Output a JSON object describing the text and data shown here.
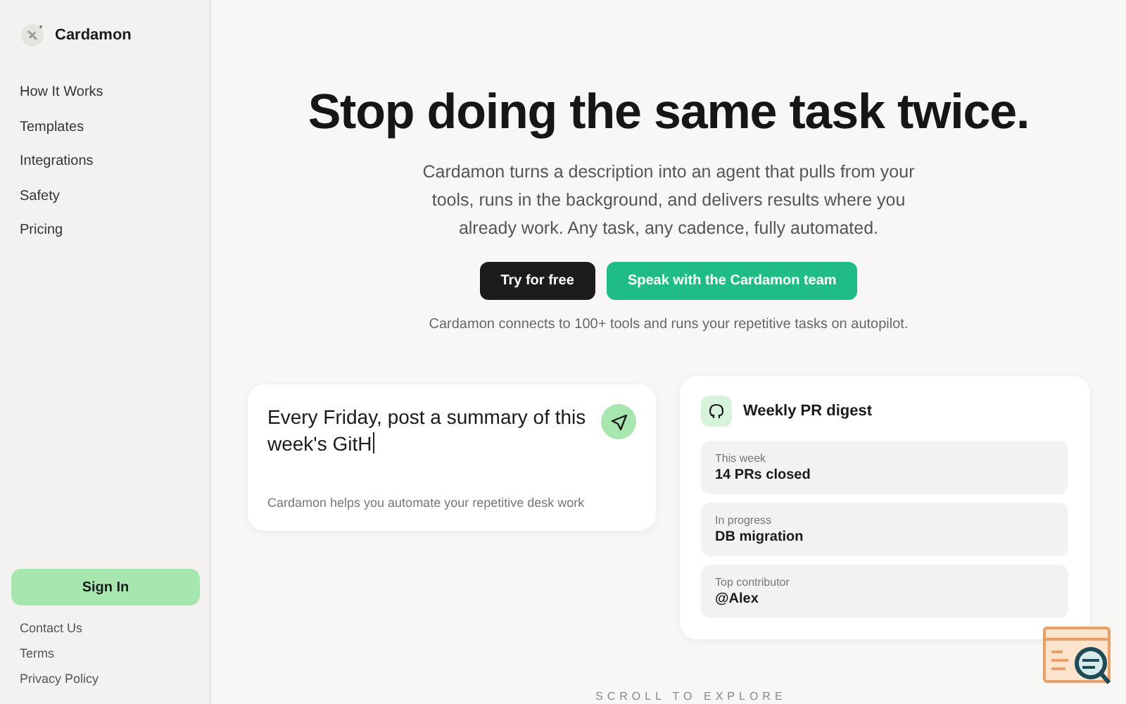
{
  "sidebar": {
    "brand": "Cardamon",
    "nav": [
      {
        "label": "How It Works"
      },
      {
        "label": "Templates"
      },
      {
        "label": "Integrations"
      },
      {
        "label": "Safety"
      },
      {
        "label": "Pricing"
      }
    ],
    "sign_in": "Sign In",
    "footer_links": [
      {
        "label": "Contact Us"
      },
      {
        "label": "Terms"
      },
      {
        "label": "Privacy Policy"
      }
    ]
  },
  "hero": {
    "title": "Stop doing the same task twice.",
    "subtitle": "Cardamon turns a description into an agent that pulls from your tools, runs in the background, and delivers results where you already work. Any task, any cadence, fully automated.",
    "buttons": [
      {
        "label": "Try for free",
        "kind": "dark"
      },
      {
        "label": "Speak with the Cardamon team",
        "kind": "accent"
      }
    ],
    "note": "Cardamon connects to 100+ tools and runs your repetitive tasks on autopilot."
  },
  "prompt_card": {
    "value": "Every Friday, post a summary of this week's GitH",
    "caption": "Cardamon helps you automate your repetitive desk work"
  },
  "digest_card": {
    "title": "Weekly PR digest",
    "rows": [
      {
        "label": "This week",
        "value": "14 PRs closed"
      },
      {
        "label": "In progress",
        "value": "DB migration"
      },
      {
        "label": "Top contributor",
        "value": "@Alex"
      }
    ]
  },
  "scroll_hint": "SCROLL TO EXPLORE"
}
